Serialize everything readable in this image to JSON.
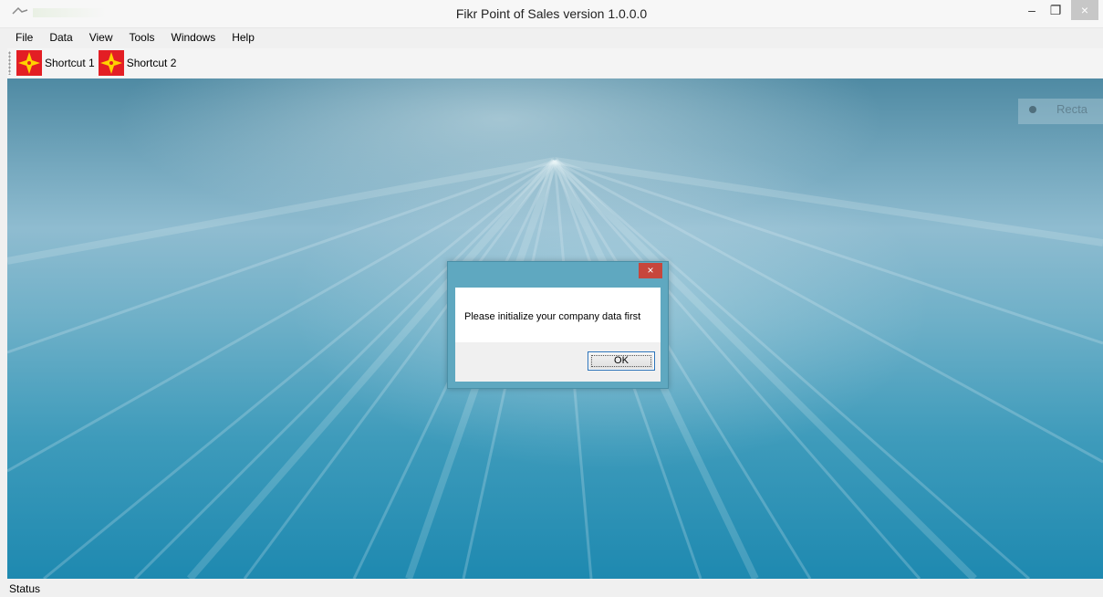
{
  "window": {
    "title": "Fikr Point of Sales version 1.0.0.0",
    "minimize_glyph": "–",
    "restore_glyph": "❐",
    "close_glyph": "×"
  },
  "menu": [
    {
      "label": "File"
    },
    {
      "label": "Data"
    },
    {
      "label": "View"
    },
    {
      "label": "Tools"
    },
    {
      "label": "Windows"
    },
    {
      "label": "Help"
    }
  ],
  "toolbar": {
    "items": [
      {
        "label": "Shortcut 1",
        "icon": "red-star-icon"
      },
      {
        "label": "Shortcut 2",
        "icon": "red-star-icon"
      }
    ]
  },
  "desktop_ghost": {
    "text": "Recta"
  },
  "dialog": {
    "close_glyph": "×",
    "message": "Please initialize your company data first",
    "ok_label": "OK"
  },
  "status": {
    "text": "Status"
  },
  "colors": {
    "close_button": "#c7463c",
    "dialog_frame": "#5fa8c0",
    "shortcut_icon_bg": "#e31e24",
    "shortcut_icon_star": "#ffd200"
  }
}
